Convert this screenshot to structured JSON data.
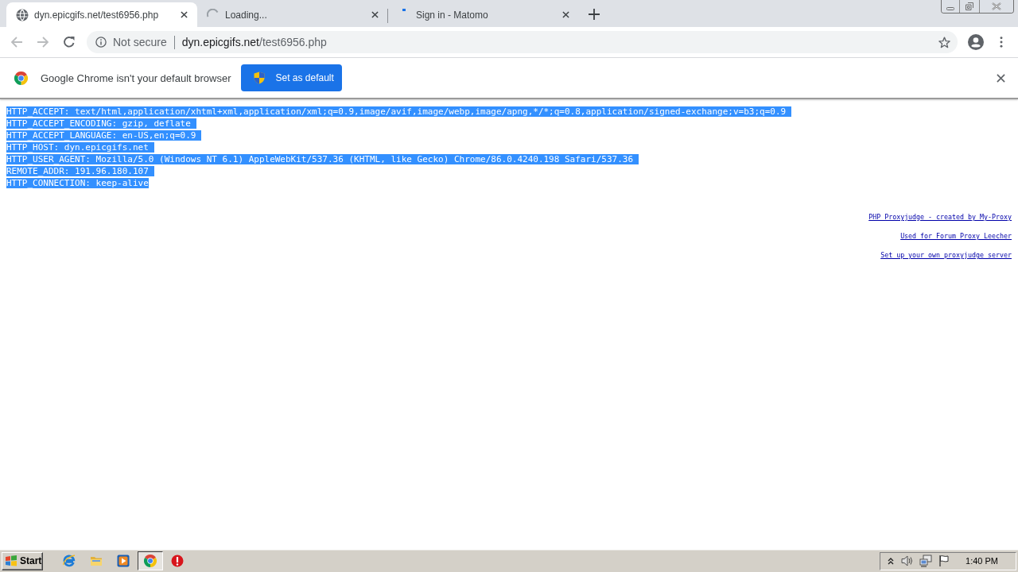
{
  "browser": {
    "tabs": [
      {
        "title": "dyn.epicgifs.net/test6956.php",
        "selected": true,
        "kind": "globe"
      },
      {
        "title": "Loading...",
        "selected": false,
        "kind": "spinner"
      },
      {
        "title": "Sign in - Matomo",
        "selected": false,
        "kind": "spinner-start"
      }
    ],
    "nav": {
      "back": {
        "disabled": true
      },
      "forward": {
        "disabled": true
      }
    },
    "address_bar": {
      "security_label": "Not secure",
      "url_host": "dyn.epicgifs.net",
      "url_path": "/test6956.php"
    },
    "infobar": {
      "message": "Google Chrome isn't your default browser",
      "button": "Set as default"
    }
  },
  "page": {
    "lines": [
      {
        "text": "HTTP_ACCEPT: text/html,application/xhtml+xml,application/xml;q=0.9,image/avif,image/webp,image/apng,*/*;q=0.8,application/signed-exchange;v=b3;q=0.9",
        "selected": true
      },
      {
        "text": "HTTP_ACCEPT_ENCODING: gzip, deflate",
        "selected": true
      },
      {
        "text": "HTTP_ACCEPT_LANGUAGE: en-US,en;q=0.9",
        "selected": true
      },
      {
        "text": "HTTP_HOST: dyn.epicgifs.net",
        "selected": true
      },
      {
        "text": "HTTP_USER_AGENT: Mozilla/5.0 (Windows NT 6.1) AppleWebKit/537.36 (KHTML, like Gecko) Chrome/86.0.4240.198 Safari/537.36",
        "selected": true
      },
      {
        "text": "REMOTE_ADDR: 191.96.180.107",
        "selected": true
      },
      {
        "text": "HTTP_CONNECTION: keep-alive",
        "selected": true
      }
    ],
    "links": [
      "PHP Proxyjudge - created by My-Proxy",
      "Used for Forum Proxy Leecher",
      "Set up your own proxyjudge server"
    ]
  },
  "taskbar": {
    "start": "Start",
    "apps": [
      {
        "kind": "ie",
        "selected": false
      },
      {
        "kind": "folder",
        "selected": false
      },
      {
        "kind": "media",
        "selected": false
      },
      {
        "kind": "chrome",
        "selected": true
      },
      {
        "kind": "stop",
        "selected": false
      }
    ],
    "clock": "1:40 PM"
  }
}
